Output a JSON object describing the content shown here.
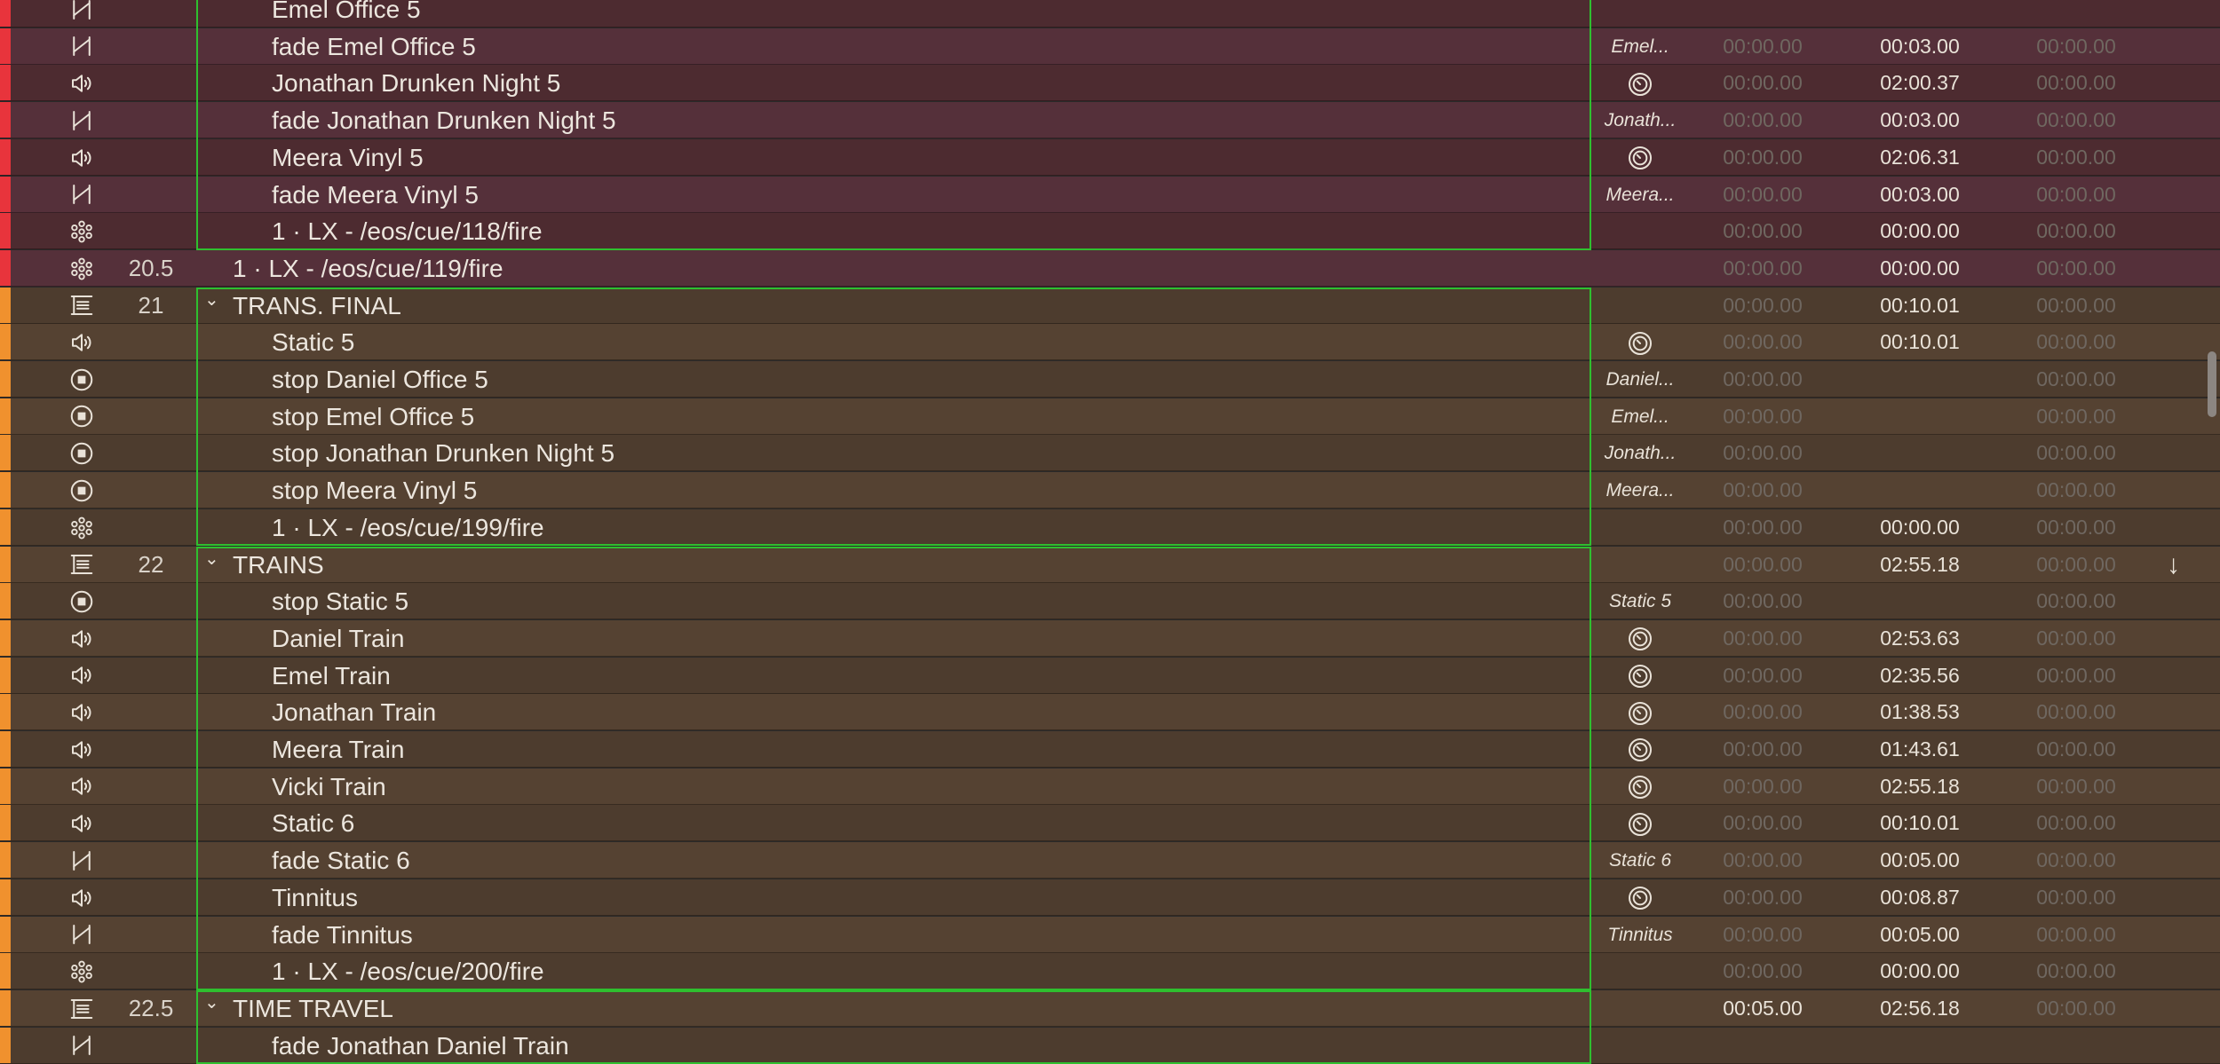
{
  "rows": [
    {
      "group": "red",
      "icon": "fade-icon",
      "number": "",
      "name": "Emel Office 5",
      "indent": "child",
      "target": "",
      "pre": "",
      "action": "",
      "post": "",
      "cut": true
    },
    {
      "group": "red",
      "icon": "fade-icon",
      "number": "",
      "name": "fade Emel Office 5",
      "indent": "child",
      "target": "Emel...",
      "pre": "00:00.00",
      "action": "00:03.00",
      "post": "00:00.00"
    },
    {
      "group": "red",
      "icon": "speaker-icon",
      "number": "",
      "name": "Jonathan Drunken Night 5",
      "indent": "child",
      "target": "timer-icon",
      "pre": "00:00.00",
      "action": "02:00.37",
      "post": "00:00.00"
    },
    {
      "group": "red",
      "icon": "fade-icon",
      "number": "",
      "name": "fade Jonathan Drunken Night 5",
      "indent": "child",
      "target": "Jonath...",
      "pre": "00:00.00",
      "action": "00:03.00",
      "post": "00:00.00"
    },
    {
      "group": "red",
      "icon": "speaker-icon",
      "number": "",
      "name": "Meera Vinyl 5",
      "indent": "child",
      "target": "timer-icon",
      "pre": "00:00.00",
      "action": "02:06.31",
      "post": "00:00.00"
    },
    {
      "group": "red",
      "icon": "fade-icon",
      "number": "",
      "name": "fade Meera Vinyl 5",
      "indent": "child",
      "target": "Meera...",
      "pre": "00:00.00",
      "action": "00:03.00",
      "post": "00:00.00"
    },
    {
      "group": "red",
      "icon": "network-icon",
      "number": "",
      "name": "1 · LX - /eos/cue/118/fire",
      "indent": "child",
      "target": "",
      "pre": "00:00.00",
      "action": "00:00.00",
      "post": "00:00.00"
    },
    {
      "group": "red",
      "icon": "network-icon",
      "number": "20.5",
      "name": "1 · LX - /eos/cue/119/fire",
      "indent": "plain",
      "target": "",
      "pre": "00:00.00",
      "action": "00:00.00",
      "post": "00:00.00"
    },
    {
      "group": "orange",
      "icon": "group-icon",
      "number": "21",
      "name": "TRANS. FINAL",
      "indent": "group",
      "target": "",
      "pre": "00:00.00",
      "action": "00:10.01",
      "post": "00:00.00"
    },
    {
      "group": "orange",
      "icon": "speaker-icon",
      "number": "",
      "name": "Static 5",
      "indent": "child",
      "target": "timer-icon",
      "pre": "00:00.00",
      "action": "00:10.01",
      "post": "00:00.00"
    },
    {
      "group": "orange",
      "icon": "stop-icon",
      "number": "",
      "name": "stop Daniel Office 5",
      "indent": "child",
      "target": "Daniel...",
      "pre": "00:00.00",
      "action": "",
      "post": "00:00.00"
    },
    {
      "group": "orange",
      "icon": "stop-icon",
      "number": "",
      "name": "stop Emel Office 5",
      "indent": "child",
      "target": "Emel...",
      "pre": "00:00.00",
      "action": "",
      "post": "00:00.00"
    },
    {
      "group": "orange",
      "icon": "stop-icon",
      "number": "",
      "name": "stop Jonathan Drunken Night 5",
      "indent": "child",
      "target": "Jonath...",
      "pre": "00:00.00",
      "action": "",
      "post": "00:00.00"
    },
    {
      "group": "orange",
      "icon": "stop-icon",
      "number": "",
      "name": "stop Meera Vinyl 5",
      "indent": "child",
      "target": "Meera...",
      "pre": "00:00.00",
      "action": "",
      "post": "00:00.00"
    },
    {
      "group": "orange",
      "icon": "network-icon",
      "number": "",
      "name": "1 · LX - /eos/cue/199/fire",
      "indent": "child",
      "target": "",
      "pre": "00:00.00",
      "action": "00:00.00",
      "post": "00:00.00"
    },
    {
      "group": "orange",
      "icon": "group-icon",
      "number": "22",
      "name": "TRAINS",
      "indent": "group",
      "target": "",
      "pre": "00:00.00",
      "action": "02:55.18",
      "post": "00:00.00",
      "arrow": true
    },
    {
      "group": "orange",
      "icon": "stop-icon",
      "number": "",
      "name": "stop Static 5",
      "indent": "child",
      "target": "Static 5",
      "pre": "00:00.00",
      "action": "",
      "post": "00:00.00"
    },
    {
      "group": "orange",
      "icon": "speaker-icon",
      "number": "",
      "name": "Daniel Train",
      "indent": "child",
      "target": "timer-icon",
      "pre": "00:00.00",
      "action": "02:53.63",
      "post": "00:00.00"
    },
    {
      "group": "orange",
      "icon": "speaker-icon",
      "number": "",
      "name": "Emel Train",
      "indent": "child",
      "target": "timer-icon",
      "pre": "00:00.00",
      "action": "02:35.56",
      "post": "00:00.00"
    },
    {
      "group": "orange",
      "icon": "speaker-icon",
      "number": "",
      "name": "Jonathan Train",
      "indent": "child",
      "target": "timer-icon",
      "pre": "00:00.00",
      "action": "01:38.53",
      "post": "00:00.00"
    },
    {
      "group": "orange",
      "icon": "speaker-icon",
      "number": "",
      "name": "Meera Train",
      "indent": "child",
      "target": "timer-icon",
      "pre": "00:00.00",
      "action": "01:43.61",
      "post": "00:00.00"
    },
    {
      "group": "orange",
      "icon": "speaker-icon",
      "number": "",
      "name": "Vicki Train",
      "indent": "child",
      "target": "timer-icon",
      "pre": "00:00.00",
      "action": "02:55.18",
      "post": "00:00.00"
    },
    {
      "group": "orange",
      "icon": "speaker-icon",
      "number": "",
      "name": "Static 6",
      "indent": "child",
      "target": "timer-icon",
      "pre": "00:00.00",
      "action": "00:10.01",
      "post": "00:00.00"
    },
    {
      "group": "orange",
      "icon": "fade-icon",
      "number": "",
      "name": "fade Static 6",
      "indent": "child",
      "target": "Static 6",
      "pre": "00:00.00",
      "action": "00:05.00",
      "post": "00:00.00"
    },
    {
      "group": "orange",
      "icon": "speaker-icon",
      "number": "",
      "name": "Tinnitus",
      "indent": "child",
      "target": "timer-icon",
      "pre": "00:00.00",
      "action": "00:08.87",
      "post": "00:00.00"
    },
    {
      "group": "orange",
      "icon": "fade-icon",
      "number": "",
      "name": "fade Tinnitus",
      "indent": "child",
      "target": "Tinnitus",
      "pre": "00:00.00",
      "action": "00:05.00",
      "post": "00:00.00"
    },
    {
      "group": "orange",
      "icon": "network-icon",
      "number": "",
      "name": "1 · LX - /eos/cue/200/fire",
      "indent": "child",
      "target": "",
      "pre": "00:00.00",
      "action": "00:00.00",
      "post": "00:00.00"
    },
    {
      "group": "orange",
      "icon": "group-icon",
      "number": "22.5",
      "name": "TIME TRAVEL",
      "indent": "group",
      "target": "",
      "pre": "00:05.00",
      "action": "02:56.18",
      "post": "00:00.00",
      "preActive": true
    },
    {
      "group": "orange",
      "icon": "fade-icon",
      "number": "",
      "name": "fade Jonathan Daniel Train",
      "indent": "child",
      "target": "",
      "pre": "",
      "action": "",
      "post": "",
      "cut": true
    }
  ],
  "colors": {
    "red_group": "#e8343c",
    "orange_group": "#f0912e",
    "group_outline": "#2fbf2f"
  }
}
